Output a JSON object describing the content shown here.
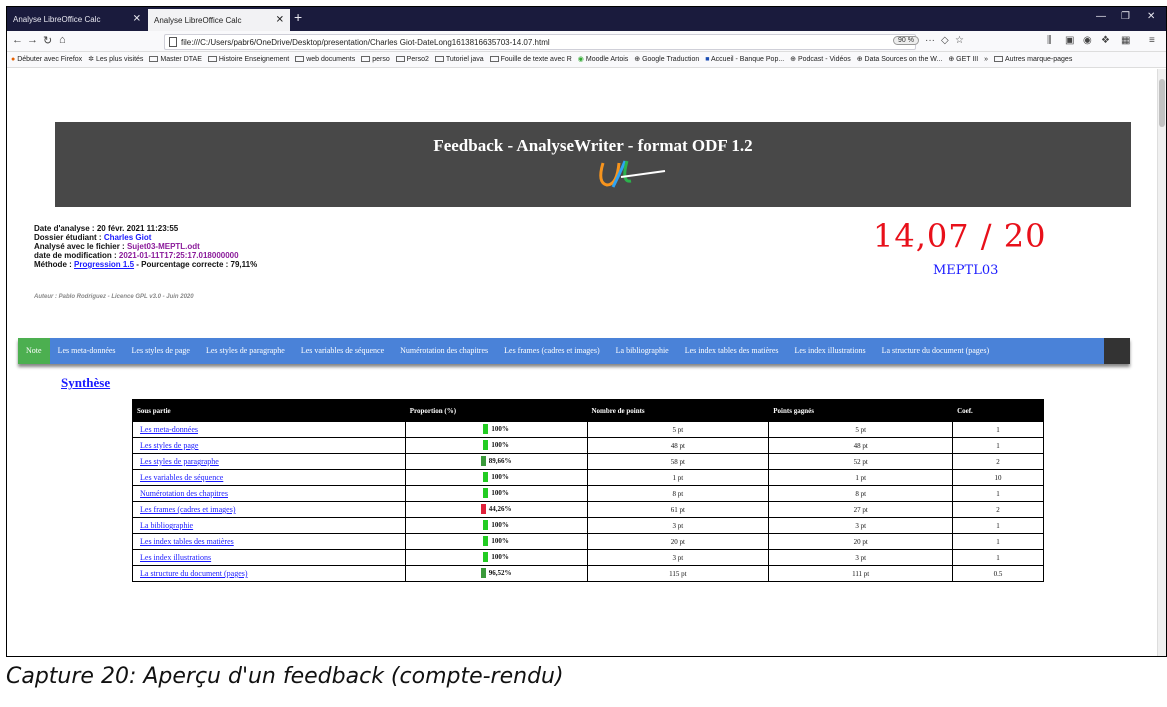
{
  "browser": {
    "tabs": [
      {
        "label": "Analyse LibreOffice Calc"
      },
      {
        "label": "Analyse LibreOffice Calc"
      }
    ],
    "url": "file:///C:/Users/pabr6/OneDrive/Desktop/presentation/Charles Giot-DateLong1613816635703-14.07.html",
    "zoom": "90 %",
    "bookmarks": [
      "Débuter avec Firefox",
      "Les plus visités",
      "Master DTAE",
      "Histoire Enseignement",
      "web documents",
      "perso",
      "Perso2",
      "Tutoriel java",
      "Fouille de texte avec R",
      "Moodle Artois",
      "Google Traduction",
      "Accueil - Banque Pop...",
      "Podcast - Vidéos",
      "Data Sources on the W...",
      "GET III",
      "Autres marque-pages"
    ]
  },
  "page": {
    "banner_title": "Feedback - AnalyseWriter - format ODF 1.2",
    "info": {
      "date_label": "Date d'analyse :",
      "date_value": "20 févr. 2021 11:23:55",
      "folder_label": "Dossier étudiant :",
      "folder_value": "Charles Giot",
      "file_label": "Analysé avec le fichier :",
      "file_value": "Sujet03-MEPTL.odt",
      "mod_label": "date de modification :",
      "mod_value": "2021-01-11T17:25:17.018000000",
      "method_label": "Méthode :",
      "method_value": "Progression 1.5",
      "percent_text": "- Pourcentage correcte : 79,11%"
    },
    "author": "Auteur : Pablo Rodriguez - Licence GPL v3.0 - Juin 2020",
    "score": "14,07 / 20",
    "subject": "MEPTL03",
    "menu": [
      "Note",
      "Les meta-données",
      "Les styles de page",
      "Les styles de paragraphe",
      "Les variables de séquence",
      "Numérotation des chapitres",
      "Les frames (cadres et images)",
      "La bibliographie",
      "Les index tables des matières",
      "Les index illustrations",
      "La structure du document (pages)"
    ],
    "synthese": "Synthèse",
    "table": {
      "headers": [
        "Sous partie",
        "Proportion (%)",
        "Nombre de points",
        "Points gagnés",
        "Coef."
      ],
      "rows": [
        {
          "name": "Les meta-données",
          "prop": "100%",
          "color": "#22cc22",
          "points": "5 pt",
          "gained": "5 pt",
          "coef": "1"
        },
        {
          "name": "Les styles de page",
          "prop": "100%",
          "color": "#22cc22",
          "points": "48 pt",
          "gained": "48 pt",
          "coef": "1"
        },
        {
          "name": "Les styles de paragraphe",
          "prop": "89,66%",
          "color": "#3a9a3a",
          "points": "58 pt",
          "gained": "52 pt",
          "coef": "2"
        },
        {
          "name": "Les variables de séquence",
          "prop": "100%",
          "color": "#22cc22",
          "points": "1 pt",
          "gained": "1 pt",
          "coef": "10"
        },
        {
          "name": "Numérotation des chapitres",
          "prop": "100%",
          "color": "#22cc22",
          "points": "8 pt",
          "gained": "8 pt",
          "coef": "1"
        },
        {
          "name": "Les frames (cadres et images)",
          "prop": "44,26%",
          "color": "#e0203a",
          "points": "61 pt",
          "gained": "27 pt",
          "coef": "2"
        },
        {
          "name": "La bibliographie",
          "prop": "100%",
          "color": "#22cc22",
          "points": "3 pt",
          "gained": "3 pt",
          "coef": "1"
        },
        {
          "name": "Les index tables des matières",
          "prop": "100%",
          "color": "#22cc22",
          "points": "20 pt",
          "gained": "20 pt",
          "coef": "1"
        },
        {
          "name": "Les index illustrations",
          "prop": "100%",
          "color": "#22cc22",
          "points": "3 pt",
          "gained": "3 pt",
          "coef": "1"
        },
        {
          "name": "La structure du document (pages)",
          "prop": "96,52%",
          "color": "#3a9a3a",
          "points": "115 pt",
          "gained": "111 pt",
          "coef": "0.5"
        }
      ]
    }
  },
  "caption": "Capture 20: Aperçu d'un feedback (compte-rendu)"
}
